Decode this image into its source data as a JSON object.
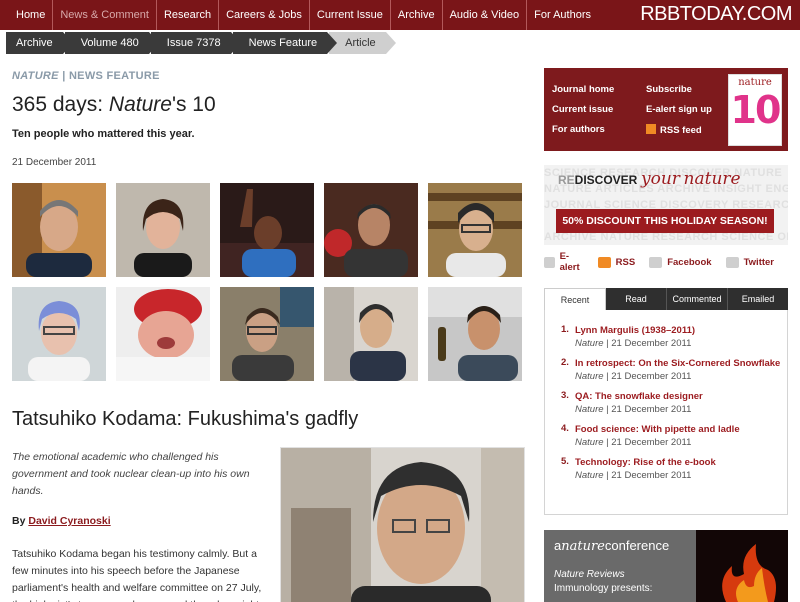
{
  "nav": {
    "items": [
      "Home",
      "News & Comment",
      "Research",
      "Careers & Jobs",
      "Current Issue",
      "Archive",
      "Audio & Video",
      "For Authors"
    ],
    "brand": "RBBTODAY.COM"
  },
  "breadcrumb": [
    "Archive",
    "Volume 480",
    "Issue 7378",
    "News Feature",
    "Article"
  ],
  "article": {
    "section_journal": "NATURE",
    "section_sep": "|",
    "section_type": "NEWS FEATURE",
    "title_lead": "365 days: ",
    "title_italic": "Nature",
    "title_tail": "'s 10",
    "standfirst": "Ten people who mattered this year.",
    "date": "21 December 2011",
    "subhead": "Tatsuhiko Kodama: Fukushima's gadfly",
    "intro": "The emotional academic who challenged his government and took nuclear clean-up into his own hands.",
    "by": "By",
    "author": "David Cyranoski",
    "body": "Tatsuhiko Kodama began his testimony calmly. But a few minutes into his speech before the Japanese parliament's health and welfare committee on 27 July, the biologist's tone grew sharp — and then downright"
  },
  "promo": {
    "journal_home": "Journal home",
    "current_issue": "Current issue",
    "for_authors": "For authors",
    "subscribe": "Subscribe",
    "ealert": "E-alert sign up",
    "rss": "RSS feed",
    "cover_brand": "nature",
    "cover_number": "10"
  },
  "rediscover": {
    "re": "RE",
    "discover": "DISCOVER",
    "your": "your",
    "nature": "nature",
    "discount": "50% DISCOUNT THIS HOLIDAY SEASON!",
    "ghost_lines": [
      "SCIENCE  RESEARCH  DISCOVER  NATURE",
      "NATURE  ARTICLES  ARCHIVE  INSIGHT  ENGAGE",
      "JOURNAL  SCIENCE  DISCOVERY  RESEARCH  NEWS",
      "ARCHIVE  NATURE  RESEARCH  SCIENCE  ONLINE"
    ]
  },
  "share": [
    "E-alert",
    "RSS",
    "Facebook",
    "Twitter"
  ],
  "tabs": [
    "Recent",
    "Read",
    "Commented",
    "Emailed"
  ],
  "recent": [
    {
      "num": "1.",
      "title": "Lynn Margulis (1938–2011)",
      "journal": "Nature",
      "date": "| 21 December 2011"
    },
    {
      "num": "2.",
      "title": "In retrospect: On the Six-Cornered Snowflake",
      "journal": "Nature",
      "date": "| 21 December 2011"
    },
    {
      "num": "3.",
      "title": "QA: The snowflake designer",
      "journal": "Nature",
      "date": "| 21 December 2011"
    },
    {
      "num": "4.",
      "title": "Food science: With pipette and ladle",
      "journal": "Nature",
      "date": "| 21 December 2011"
    },
    {
      "num": "5.",
      "title": "Technology: Rise of the e-book",
      "journal": "Nature",
      "date": "| 21 December 2011"
    }
  ],
  "conference": {
    "pre": "a",
    "brand": "nature",
    "post": "conference",
    "line1": "Nature Reviews",
    "line2": "Immunology presents:"
  }
}
